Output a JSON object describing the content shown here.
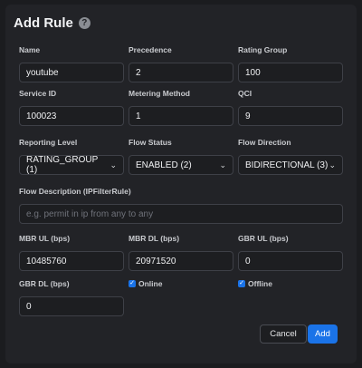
{
  "dialog": {
    "title": "Add Rule",
    "help_icon": "?"
  },
  "fields": {
    "name": {
      "label": "Name",
      "value": "youtube"
    },
    "precedence": {
      "label": "Precedence",
      "value": "2"
    },
    "rating_group": {
      "label": "Rating Group",
      "value": "100"
    },
    "service_id": {
      "label": "Service ID",
      "value": "100023"
    },
    "metering_method": {
      "label": "Metering Method",
      "value": "1"
    },
    "qci": {
      "label": "QCI",
      "value": "9"
    },
    "reporting_level": {
      "label": "Reporting Level",
      "value": "RATING_GROUP (1)"
    },
    "flow_status": {
      "label": "Flow Status",
      "value": "ENABLED (2)"
    },
    "flow_direction": {
      "label": "Flow Direction",
      "value": "BIDIRECTIONAL (3)"
    },
    "flow_description": {
      "label": "Flow Description (IPFilterRule)",
      "value": "",
      "placeholder": "e.g. permit in ip from any to any"
    },
    "mbr_ul": {
      "label": "MBR UL (bps)",
      "value": "10485760"
    },
    "mbr_dl": {
      "label": "MBR DL (bps)",
      "value": "20971520"
    },
    "gbr_ul": {
      "label": "GBR UL (bps)",
      "value": "0"
    },
    "gbr_dl": {
      "label": "GBR DL (bps)",
      "value": "0"
    }
  },
  "checks": {
    "online": {
      "label": "Online",
      "checked": true
    },
    "offline": {
      "label": "Offline",
      "checked": true
    }
  },
  "buttons": {
    "cancel": "Cancel",
    "add": "Add"
  },
  "colors": {
    "accent": "#1a73e8",
    "background": "#222327"
  }
}
